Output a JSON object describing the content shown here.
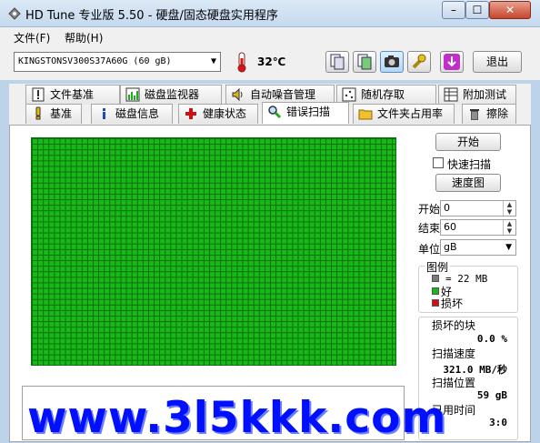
{
  "window": {
    "title": "HD Tune 专业版 5.50 - 硬盘/固态硬盘实用程序",
    "min": "–",
    "max": "☐",
    "close": "✕"
  },
  "menu": [
    {
      "label": "文件(F)"
    },
    {
      "label": "帮助(H)"
    }
  ],
  "toolbar": {
    "drive": "KINGSTONSV300S37A60G (60 gB)",
    "temperature": "32℃",
    "exit_label": "退出"
  },
  "tabs_row1": [
    {
      "label": "文件基准"
    },
    {
      "label": "磁盘监视器"
    },
    {
      "label": "自动噪音管理"
    },
    {
      "label": "随机存取"
    },
    {
      "label": "附加测试"
    }
  ],
  "tabs_row2": [
    {
      "label": "基准"
    },
    {
      "label": "磁盘信息"
    },
    {
      "label": "健康状态"
    },
    {
      "label": "错误扫描"
    },
    {
      "label": "文件夹占用率"
    },
    {
      "label": "擦除"
    }
  ],
  "scan": {
    "start_button": "开始",
    "quick_scan_label": "快速扫描",
    "speed_map_button": "速度图",
    "start_label": "开始",
    "start_value": "0",
    "end_label": "结束",
    "end_value": "60",
    "unit_label": "单位",
    "unit_value": "gB"
  },
  "legend": {
    "title": "图例",
    "block_size": "= 22 MB",
    "good": "好",
    "bad": "损坏",
    "colors": {
      "block": "#7a7a7a",
      "good": "#17b817",
      "bad": "#d01010"
    }
  },
  "stats": {
    "damaged_label": "损坏的块",
    "damaged_value": "0.0 %",
    "speed_label": "扫描速度",
    "speed_value": "321.0 MB/秒",
    "position_label": "扫描位置",
    "position_value": "59 gB",
    "elapsed_label": "已用时间",
    "elapsed_value": "3:0"
  },
  "watermark": "www.3l5kkk.com"
}
